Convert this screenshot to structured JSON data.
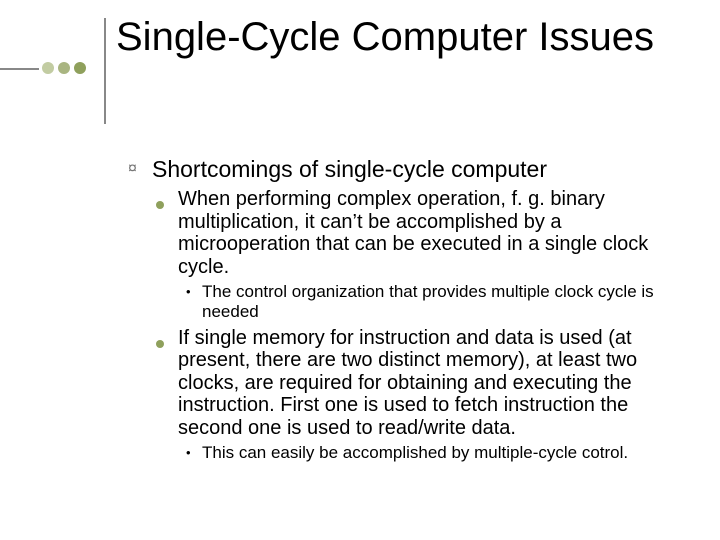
{
  "title": "Single-Cycle Computer Issues",
  "body": {
    "l1_0": "Shortcomings of single-cycle computer",
    "l2_0": "When performing complex operation, f. g. binary multiplication, it can’t be accomplished by a microoperation that can be executed in a single clock cycle.",
    "l3_0": "The control organization that provides multiple clock cycle is needed",
    "l2_1": "If single memory for instruction and data is used (at present, there are two distinct memory), at least two clocks, are required for obtaining and executing the instruction. First one is used to fetch instruction the second one is used to read/write data.",
    "l3_1": "This can easily be accomplished by multiple-cycle cotrol."
  },
  "bullets": {
    "hollow": "¤",
    "dash": "•"
  }
}
